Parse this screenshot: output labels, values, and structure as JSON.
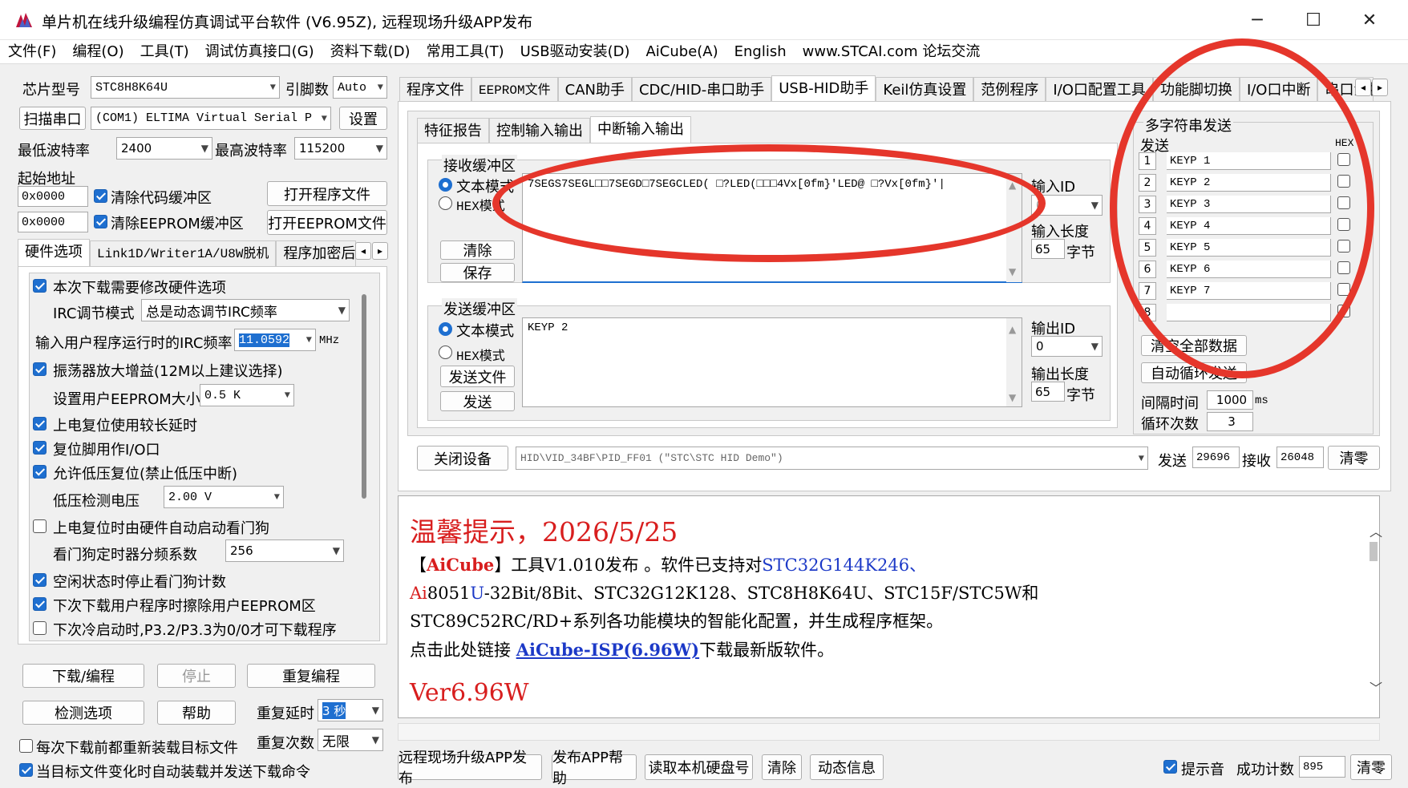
{
  "window": {
    "title": "单片机在线升级编程仿真调试平台软件 (V6.95Z), 远程现场升级APP发布",
    "minimize_glyph": "─",
    "maximize_glyph": "☐",
    "close_glyph": "✕"
  },
  "menu": [
    "文件(F)",
    "编程(O)",
    "工具(T)",
    "调试仿真接口(G)",
    "资料下载(D)",
    "常用工具(T)",
    "USB驱动安装(D)",
    "AiCube(A)",
    "English",
    "www.STCAI.com 论坛交流"
  ],
  "left": {
    "chip_label": "芯片型号",
    "chip_value": "STC8H8K64U",
    "pins_label": "引脚数",
    "pins_value": "Auto",
    "scan_button": "扫描串口",
    "port_value": "(COM1) ELTIMA Virtual Serial Port",
    "settings_button": "设置",
    "min_baud_label": "最低波特率",
    "min_baud_value": "2400",
    "max_baud_label": "最高波特率",
    "max_baud_value": "115200",
    "start_addr_label": "起始地址",
    "addr1": "0x0000",
    "clear_code": "清除代码缓冲区",
    "open_prog": "打开程序文件",
    "addr2": "0x0000",
    "clear_eeprom": "清除EEPROM缓冲区",
    "open_eeprom": "打开EEPROM文件",
    "tabs": [
      "硬件选项",
      "Link1D/Writer1A/U8W脱机",
      "程序加密后"
    ],
    "tab_scroll_left": "◂",
    "tab_scroll_right": "▸",
    "opt_modify": "本次下载需要修改硬件选项",
    "irc_mode_label": "IRC调节模式",
    "irc_mode_value": "总是动态调节IRC频率",
    "irc_freq_label": "输入用户程序运行时的IRC频率",
    "irc_freq_value": "11.0592",
    "irc_freq_unit": "MHz",
    "opt_osc": "振荡器放大增益(12M以上建议选择)",
    "eeprom_size_label": "设置用户EEPROM大小",
    "eeprom_size_value": "0.5 K",
    "opt_long_reset": "上电复位使用较长延时",
    "opt_reset_io": "复位脚用作I/O口",
    "opt_lvd": "允许低压复位(禁止低压中断)",
    "lvd_label": "低压检测电压",
    "lvd_value": "2.00 V",
    "opt_wdt": "上电复位时由硬件自动启动看门狗",
    "wdt_label": "看门狗定时器分频系数",
    "wdt_value": "256",
    "opt_idle_wdt": "空闲状态时停止看门狗计数",
    "opt_erase_eeprom": "下次下载用户程序时擦除用户EEPROM区",
    "opt_cold_boot": "下次冷启动时,P3.2/P3.3为0/0才可下载程序",
    "download_button": "下载/编程",
    "stop_button": "停止",
    "repeat_button": "重复编程",
    "check_button": "检测选项",
    "help_button": "帮助",
    "repeat_delay_label": "重复延时",
    "repeat_delay_value": "3 秒",
    "repeat_count_label": "重复次数",
    "repeat_count_value": "无限",
    "reload_each": "每次下载前都重新装载目标文件",
    "auto_reload": "当目标文件变化时自动装载并发送下载命令"
  },
  "right_tabs": [
    "程序文件",
    "EEPROM文件",
    "CAN助手",
    "CDC/HID-串口助手",
    "USB-HID助手",
    "Keil仿真设置",
    "范例程序",
    "I/O口配置工具",
    "功能脚切换",
    "I/O口中断",
    "串口波特"
  ],
  "hid": {
    "subtabs": [
      "特征报告",
      "控制输入输出",
      "中断输入输出"
    ],
    "recv_group": "接收缓冲区",
    "text_mode": "文本模式",
    "hex_mode": "HEX模式",
    "recv_text": "7SEGS7SEGL□□7SEGD□7SEGCLED( □?LED(□□□4Vx[0fm}'LED@ □?Vx[0fm}'|",
    "clear_button": "清除",
    "save_button": "保存",
    "input_id_label": "输入ID",
    "input_id_value": "0",
    "input_len_label": "输入长度",
    "input_len_value": "65",
    "byte_unit": "字节",
    "send_group": "发送缓冲区",
    "send_text": "KEYP 2",
    "send_file_button": "发送文件",
    "send_button": "发送",
    "output_id_label": "输出ID",
    "output_id_value": "0",
    "output_len_label": "输出长度",
    "output_len_value": "65",
    "multi_title": "多字符串发送",
    "multi_send": "发送",
    "multi_hex": "HEX",
    "multi_rows": [
      {
        "n": "1",
        "text": "KEYP 1"
      },
      {
        "n": "2",
        "text": "KEYP 2"
      },
      {
        "n": "3",
        "text": "KEYP 3"
      },
      {
        "n": "4",
        "text": "KEYP 4"
      },
      {
        "n": "5",
        "text": "KEYP 5"
      },
      {
        "n": "6",
        "text": "KEYP 6"
      },
      {
        "n": "7",
        "text": "KEYP 7"
      },
      {
        "n": "8",
        "text": ""
      }
    ],
    "clear_all": "清空全部数据",
    "auto_loop": "自动循环发送",
    "interval_label": "间隔时间",
    "interval_value": "1000",
    "interval_unit": "ms",
    "loop_label": "循环次数",
    "loop_value": "3",
    "close_device": "关闭设备",
    "device_path": "HID\\VID_34BF\\PID_FF01 (\"STC\\STC HID Demo\")",
    "send_count_label": "发送",
    "send_count": "29696",
    "recv_count_label": "接收",
    "recv_count": "26048",
    "zero_button": "清零"
  },
  "notice": {
    "heading": "温馨提示，2026/5/25",
    "l1_a": "【",
    "l1_b": "AiCube",
    "l1_c": "】工具V1.010发布 。软件已支持对",
    "l1_d": "STC32G144K246、",
    "l2_a": "Ai",
    "l2_b": "8051",
    "l2_c": "U",
    "l2_d": "-32Bit/8Bit、STC32G12K128、STC8H8K64U、STC15F/STC5W和",
    "l3": "STC89C52RC/RD+系列各功能模块的智能化配置，并生成程序框架。",
    "l4_a": "点击此处链接 ",
    "l4_b": "AiCube-ISP(6.96W)",
    "l4_c": "下载最新版软件。",
    "l5": "Ver6.96W"
  },
  "bottom": {
    "remote_btn": "远程现场升级APP发布",
    "app_help": "发布APP帮助",
    "read_hdd": "读取本机硬盘号",
    "clear": "清除",
    "dyn_info": "动态信息",
    "beep_label": "提示音",
    "success_label": "成功计数",
    "success_value": "895",
    "zero_button": "清零"
  },
  "colors": {
    "accent": "#1e6fd0",
    "annotation": "#e5362b",
    "notice_red": "#d81e1e",
    "notice_blue": "#1c39c7"
  }
}
